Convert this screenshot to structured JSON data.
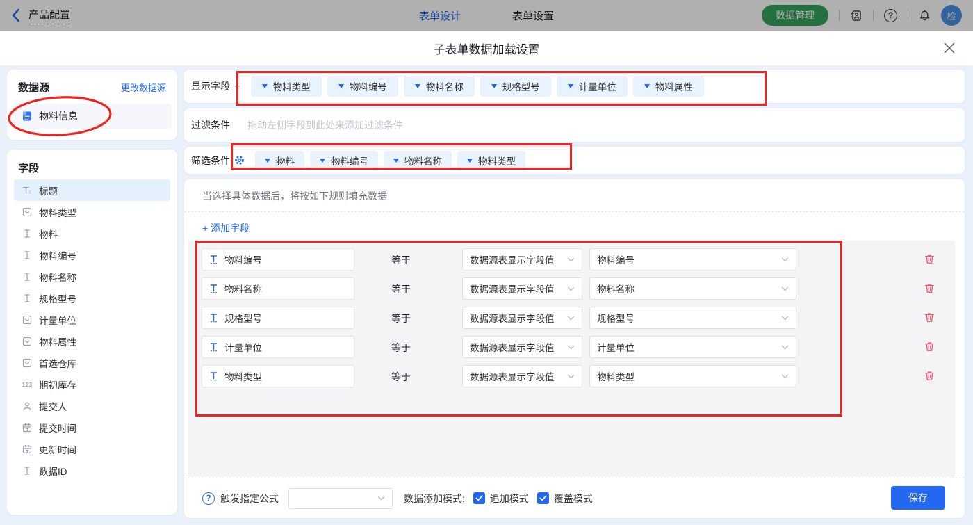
{
  "colors": {
    "accent": "#2468f2",
    "header_green": "#36a35e",
    "danger": "#f2566e",
    "annotation_red": "#ee2420",
    "body_bg": "#eaf1fb",
    "tag_bg": "#e8f3fe"
  },
  "header": {
    "back_label": "产品配置",
    "tabs": [
      {
        "label": "表单设计",
        "active": true
      },
      {
        "label": "表单设置",
        "active": false
      }
    ],
    "data_manage_label": "数据管理",
    "avatar_text": "检"
  },
  "modal": {
    "title": "子表单数据加载设置"
  },
  "sidebar": {
    "datasource_title": "数据源",
    "change_datasource_label": "更改数据源",
    "datasource_name": "物料信息",
    "fields_title": "字段",
    "number_icon_text": "123",
    "fields": [
      {
        "label": "标题",
        "icon": "title-icon",
        "active": true
      },
      {
        "label": "物料类型",
        "icon": "select-icon"
      },
      {
        "label": "物料",
        "icon": "text-icon"
      },
      {
        "label": "物料编号",
        "icon": "text-icon"
      },
      {
        "label": "物料名称",
        "icon": "text-icon"
      },
      {
        "label": "规格型号",
        "icon": "text-icon"
      },
      {
        "label": "计量单位",
        "icon": "select-icon"
      },
      {
        "label": "物料属性",
        "icon": "select-icon"
      },
      {
        "label": "首选仓库",
        "icon": "select-icon"
      },
      {
        "label": "期初库存",
        "icon": "number-icon"
      },
      {
        "label": "提交人",
        "icon": "person-icon"
      },
      {
        "label": "提交时间",
        "icon": "calendar-icon"
      },
      {
        "label": "更新时间",
        "icon": "calendar-icon"
      },
      {
        "label": "数据ID",
        "icon": "text-icon"
      }
    ]
  },
  "main": {
    "display_row": {
      "label": "显示字段",
      "tags": [
        "物料类型",
        "物料编号",
        "物料名称",
        "规格型号",
        "计量单位",
        "物料属性"
      ]
    },
    "filter_row": {
      "label": "过滤条件",
      "placeholder": "拖动左侧字段到此处来添加过滤条件"
    },
    "screen_row": {
      "label": "筛选条件",
      "tags": [
        "物料",
        "物料编号",
        "物料名称",
        "物料类型"
      ]
    },
    "rule_hint": "当选择具体数据后，将按如下规则填充数据",
    "add_field_label": "+ 添加字段",
    "rules": [
      {
        "field": "物料编号",
        "operator": "等于",
        "source": "数据源表显示字段值",
        "target": "物料编号"
      },
      {
        "field": "物料名称",
        "operator": "等于",
        "source": "数据源表显示字段值",
        "target": "物料名称"
      },
      {
        "field": "规格型号",
        "operator": "等于",
        "source": "数据源表显示字段值",
        "target": "规格型号"
      },
      {
        "field": "计量单位",
        "operator": "等于",
        "source": "数据源表显示字段值",
        "target": "计量单位"
      },
      {
        "field": "物料类型",
        "operator": "等于",
        "source": "数据源表显示字段值",
        "target": "物料类型"
      }
    ]
  },
  "footer": {
    "formula_label": "触发指定公式",
    "formula_value": "",
    "mode_label": "数据添加模式:",
    "modes": [
      {
        "label": "追加模式",
        "checked": true
      },
      {
        "label": "覆盖模式",
        "checked": true
      }
    ],
    "save_label": "保存"
  }
}
